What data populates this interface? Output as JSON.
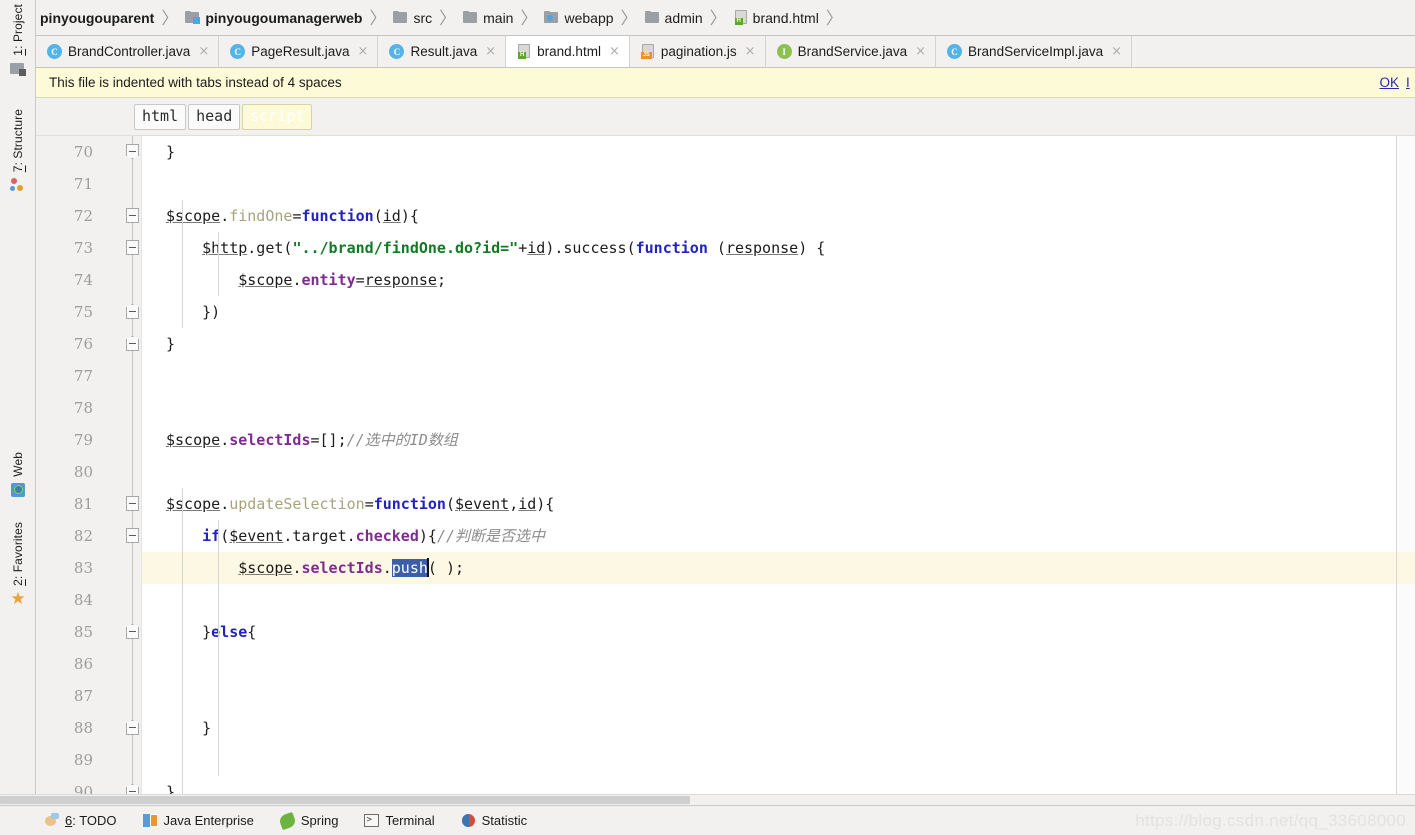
{
  "navbar": {
    "crumbs": [
      {
        "label": "pinyougouparent",
        "icon": "module-folder-icon",
        "bold": true
      },
      {
        "label": "pinyougoumanagerweb",
        "icon": "module-folder-icon",
        "bold": true
      },
      {
        "label": "src",
        "icon": "folder-icon",
        "bold": false
      },
      {
        "label": "main",
        "icon": "folder-icon",
        "bold": false
      },
      {
        "label": "webapp",
        "icon": "source-folder-icon",
        "bold": false
      },
      {
        "label": "admin",
        "icon": "folder-icon",
        "bold": false
      },
      {
        "label": "brand.html",
        "icon": "html-file-icon",
        "bold": false
      }
    ],
    "separator": "〉"
  },
  "tabs": [
    {
      "label": "BrandController.java",
      "icon": "java-class-icon",
      "icon_letter": "C",
      "active": false,
      "close": "×"
    },
    {
      "label": "PageResult.java",
      "icon": "java-class-icon",
      "icon_letter": "C",
      "active": false,
      "close": "×"
    },
    {
      "label": "Result.java",
      "icon": "java-class-icon",
      "icon_letter": "C",
      "active": false,
      "close": "×"
    },
    {
      "label": "brand.html",
      "icon": "html-file-icon",
      "icon_letter": "",
      "active": true,
      "close": "×"
    },
    {
      "label": "pagination.js",
      "icon": "js-file-icon",
      "icon_letter": "",
      "active": false,
      "close": "×"
    },
    {
      "label": "BrandService.java",
      "icon": "java-interface-icon",
      "icon_letter": "I",
      "active": false,
      "close": "×"
    },
    {
      "label": "BrandServiceImpl.java",
      "icon": "java-class-icon",
      "icon_letter": "C",
      "active": false,
      "close": "×"
    }
  ],
  "notice": {
    "message": "This file is indented with tabs instead of 4 spaces",
    "ok_label": "OK",
    "second_label": "I"
  },
  "html_breadcrumbs": [
    {
      "label": "html",
      "selected": false
    },
    {
      "label": "head",
      "selected": false
    },
    {
      "label": "script",
      "selected": true
    }
  ],
  "left_stripe_top": [
    {
      "label_prefix": "1",
      "label": ": Project",
      "icon": "project-icon"
    },
    {
      "label_prefix": "7",
      "label": ": Structure",
      "icon": "structure-icon"
    }
  ],
  "left_stripe_bottom": [
    {
      "label_prefix": "",
      "label": "Web",
      "icon": "web-icon"
    },
    {
      "label_prefix": "2",
      "label": ": Favorites",
      "icon": "star-icon"
    }
  ],
  "editor": {
    "first_line": 70,
    "highlight_line": 83,
    "lines": [
      {
        "n": 70,
        "fold": "end",
        "text": "}"
      },
      {
        "n": 71,
        "fold": "",
        "text": ""
      },
      {
        "n": 72,
        "fold": "mid",
        "text": "$scope.findOne=function(id){"
      },
      {
        "n": 73,
        "fold": "mid",
        "text": "    $http.get(\"../brand/findOne.do?id=\"+id).success(function (response) {"
      },
      {
        "n": 74,
        "fold": "",
        "text": "        $scope.entity=response;"
      },
      {
        "n": 75,
        "fold": "start",
        "text": "    })"
      },
      {
        "n": 76,
        "fold": "start",
        "text": "}"
      },
      {
        "n": 77,
        "fold": "",
        "text": ""
      },
      {
        "n": 78,
        "fold": "",
        "text": ""
      },
      {
        "n": 79,
        "fold": "",
        "text": "$scope.selectIds=[];//选中的ID数组"
      },
      {
        "n": 80,
        "fold": "",
        "text": ""
      },
      {
        "n": 81,
        "fold": "mid",
        "text": "$scope.updateSelection=function($event,id){"
      },
      {
        "n": 82,
        "fold": "mid",
        "text": "    if($event.target.checked){//判断是否选中"
      },
      {
        "n": 83,
        "fold": "",
        "text": "        $scope.selectIds.push( );"
      },
      {
        "n": 84,
        "fold": "",
        "text": ""
      },
      {
        "n": 85,
        "fold": "start",
        "text": "    }else{"
      },
      {
        "n": 86,
        "fold": "",
        "text": ""
      },
      {
        "n": 87,
        "fold": "",
        "text": ""
      },
      {
        "n": 88,
        "fold": "start",
        "text": "    }"
      },
      {
        "n": 89,
        "fold": "",
        "text": ""
      },
      {
        "n": 90,
        "fold": "start",
        "text": "}"
      }
    ],
    "selection_text": "push",
    "caret_char": "│"
  },
  "statusbar": [
    {
      "prefix": "6",
      "label": ": TODO",
      "icon": "todo-icon"
    },
    {
      "prefix": "",
      "label": "Java Enterprise",
      "icon": "java-enterprise-icon"
    },
    {
      "prefix": "",
      "label": "Spring",
      "icon": "spring-icon"
    },
    {
      "prefix": "",
      "label": "Terminal",
      "icon": "terminal-icon"
    },
    {
      "prefix": "",
      "label": "Statistic",
      "icon": "statistic-icon"
    }
  ],
  "watermark": "https://blog.csdn.net/qq_33608000",
  "colors": {
    "keyword": "#2222c0",
    "string": "#127a25",
    "property": "#7d2c8f",
    "comment": "#8c8c8c",
    "selection": "#3b5ea8",
    "line_highlight": "#fdf8e3",
    "notice_bg": "#fdfbd7"
  }
}
